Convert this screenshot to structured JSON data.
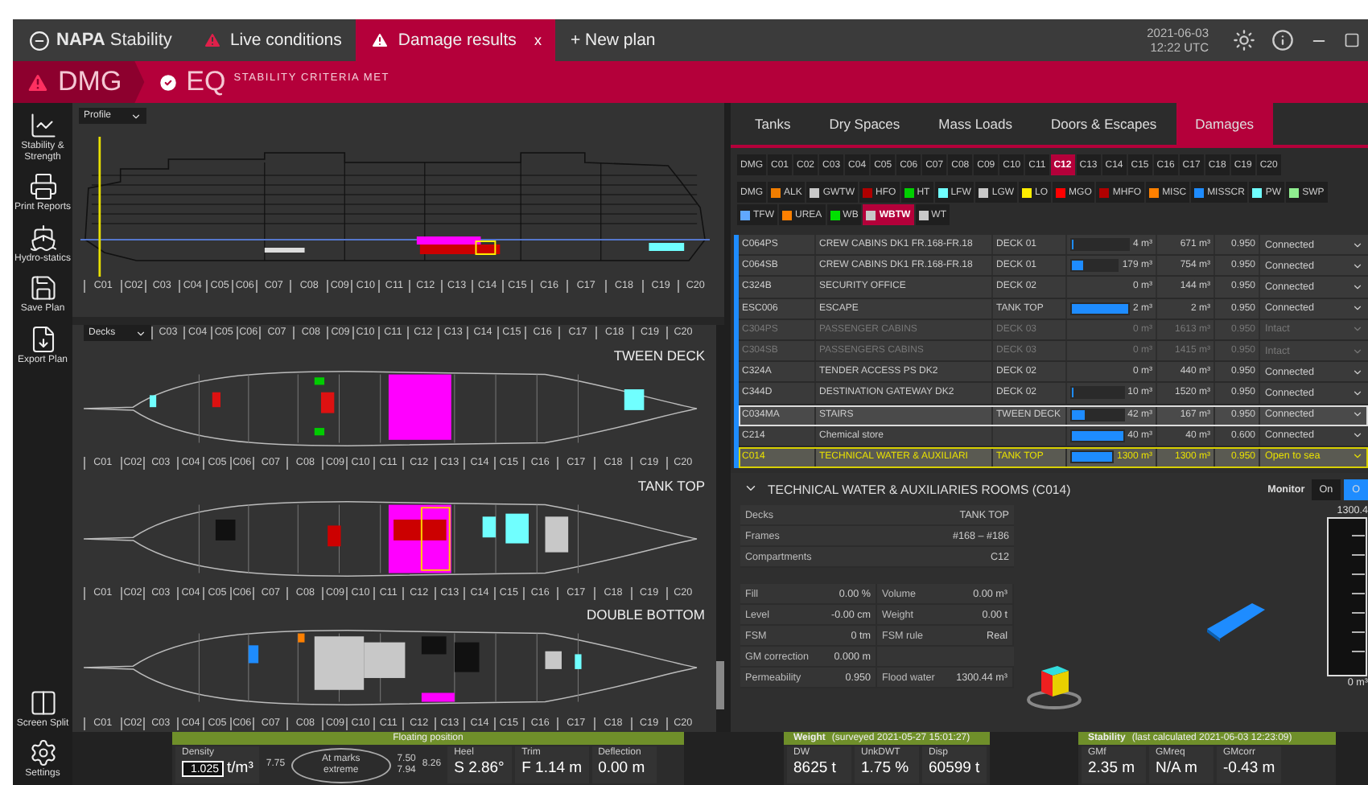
{
  "app": {
    "title": "**NAPA** Stability"
  },
  "tabs": [
    {
      "label": "Live conditions",
      "selected": false
    },
    {
      "label": "Damage results",
      "selected": true,
      "close": "x"
    },
    {
      "label": "+ New plan",
      "selected": false
    }
  ],
  "clock": {
    "date": "2021-06-03",
    "time": "12:22 UTC"
  },
  "status_strip": {
    "mode": "DMG",
    "state": "EQ",
    "message": "STABILITY CRITERIA MET"
  },
  "sidebar": {
    "items": [
      {
        "label": "Stability & Strength"
      },
      {
        "label": "Print Reports"
      },
      {
        "label": "Hydro-statics"
      },
      {
        "label": "Save Plan"
      },
      {
        "label": "Export Plan"
      }
    ],
    "bottom_items": [
      {
        "label": "Screen Split"
      },
      {
        "label": "Settings"
      }
    ]
  },
  "profile_view": {
    "view": "Profile",
    "scale": [
      "C01",
      "C02",
      "C03",
      "C04",
      "C05",
      "C06",
      "C07",
      "C08",
      "C09",
      "C10",
      "C11",
      "C12",
      "C13",
      "C14",
      "C15",
      "C16",
      "C17",
      "C18",
      "C19",
      "C20"
    ]
  },
  "deck_view": {
    "view": "Decks",
    "scale": [
      "C03",
      "C04",
      "C05",
      "C06",
      "C07",
      "C08",
      "C09",
      "C10",
      "C11",
      "C12",
      "C13",
      "C14",
      "C15",
      "C16",
      "C17",
      "C18",
      "C19",
      "C20"
    ],
    "decks": [
      {
        "name": "TWEEN DECK",
        "scale": [
          "C01",
          "C02",
          "C03",
          "C04",
          "C05",
          "C06",
          "C07",
          "C08",
          "C09",
          "C10",
          "C11",
          "C12",
          "C13",
          "C14",
          "C15",
          "C16",
          "C17",
          "C18",
          "C19",
          "C20"
        ]
      },
      {
        "name": "TANK TOP",
        "scale": [
          "C01",
          "C02",
          "C03",
          "C04",
          "C05",
          "C06",
          "C07",
          "C08",
          "C09",
          "C10",
          "C11",
          "C12",
          "C13",
          "C14",
          "C15",
          "C16",
          "C17",
          "C18",
          "C19",
          "C20"
        ]
      },
      {
        "name": "DOUBLE BOTTOM",
        "scale": [
          "C01",
          "C02",
          "C03",
          "C04",
          "C05",
          "C06",
          "C07",
          "C08",
          "C09",
          "C10",
          "C11",
          "C12",
          "C13",
          "C14",
          "C15",
          "C16",
          "C17",
          "C18",
          "C19",
          "C20"
        ]
      }
    ]
  },
  "panel_tabs": [
    {
      "label": "Tanks",
      "selected": false
    },
    {
      "label": "Dry Spaces",
      "selected": false
    },
    {
      "label": "Mass Loads",
      "selected": false
    },
    {
      "label": "Doors & Escapes",
      "selected": false
    },
    {
      "label": "Damages",
      "selected": true
    }
  ],
  "compartment_filters": [
    {
      "label": "DMG",
      "selected": false
    },
    {
      "label": "C01",
      "selected": false
    },
    {
      "label": "C02",
      "selected": false
    },
    {
      "label": "C03",
      "selected": false
    },
    {
      "label": "C04",
      "selected": false
    },
    {
      "label": "C05",
      "selected": false
    },
    {
      "label": "C06",
      "selected": false
    },
    {
      "label": "C07",
      "selected": false
    },
    {
      "label": "C08",
      "selected": false
    },
    {
      "label": "C09",
      "selected": false
    },
    {
      "label": "C10",
      "selected": false
    },
    {
      "label": "C11",
      "selected": false
    },
    {
      "label": "C12",
      "selected": true
    },
    {
      "label": "C13",
      "selected": false
    },
    {
      "label": "C14",
      "selected": false
    },
    {
      "label": "C15",
      "selected": false
    },
    {
      "label": "C16",
      "selected": false
    },
    {
      "label": "C17",
      "selected": false
    },
    {
      "label": "C18",
      "selected": false
    },
    {
      "label": "C19",
      "selected": false
    },
    {
      "label": "C20",
      "selected": false
    }
  ],
  "type_filters": [
    {
      "label": "DMG",
      "selected": false
    },
    {
      "label": "ALK",
      "color": "#f07d00",
      "selected": false
    },
    {
      "label": "GWTW",
      "color": "#c8c8c8",
      "selected": false
    },
    {
      "label": "HFO",
      "color": "#b00000",
      "selected": false
    },
    {
      "label": "HT",
      "color": "#00d000",
      "selected": false
    },
    {
      "label": "LFW",
      "color": "#70ffff",
      "selected": false
    },
    {
      "label": "LGW",
      "color": "#c8c8c8",
      "selected": false
    },
    {
      "label": "LO",
      "color": "#ffee00",
      "selected": false
    },
    {
      "label": "MGO",
      "color": "#ff0000",
      "selected": false
    },
    {
      "label": "MHFO",
      "color": "#b00000",
      "selected": false
    },
    {
      "label": "MISC",
      "color": "#ff8000",
      "selected": false
    },
    {
      "label": "MISSCR",
      "color": "#1e8cff",
      "selected": false
    },
    {
      "label": "PW",
      "color": "#70ffff",
      "selected": false
    },
    {
      "label": "SWP",
      "color": "#90ee90",
      "selected": false
    },
    {
      "label": "TFW",
      "color": "#60a8ff",
      "selected": false
    },
    {
      "label": "UREA",
      "color": "#ff8000",
      "selected": false
    },
    {
      "label": "WB",
      "color": "#00e000",
      "selected": false
    },
    {
      "label": "WBTW",
      "color": "#c8c8c8",
      "selected": true
    },
    {
      "label": "WT",
      "color": "#c8c8c8",
      "selected": false
    }
  ],
  "damage_table": {
    "rows": [
      {
        "id": "C064PS",
        "name": "CREW CABINS DK1 FR.168-FR.18",
        "deck": "DECK 01",
        "volume": "4 m³",
        "capacity": "671 m³",
        "permeability": "0.950",
        "status": "Connected",
        "level": 0.01,
        "selected": false,
        "highlighted": false,
        "disabled": false
      },
      {
        "id": "C064SB",
        "name": "CREW CABINS DK1 FR.168-FR.18",
        "deck": "DECK 01",
        "volume": "179 m³",
        "capacity": "754 m³",
        "permeability": "0.950",
        "status": "Connected",
        "level": 0.24,
        "selected": false,
        "highlighted": false,
        "disabled": false
      },
      {
        "id": "C324B",
        "name": "SECURITY OFFICE",
        "deck": "DECK 02",
        "volume": "0 m³",
        "capacity": "144 m³",
        "permeability": "0.950",
        "status": "Connected",
        "selected": false,
        "highlighted": false,
        "disabled": false
      },
      {
        "id": "ESC006",
        "name": "ESCAPE",
        "deck": "TANK TOP",
        "volume": "2 m³",
        "capacity": "2 m³",
        "permeability": "0.950",
        "status": "Connected",
        "level": 1,
        "selected": false,
        "highlighted": false,
        "disabled": false
      },
      {
        "id": "C304PS",
        "name": "PASSENGER CABINS",
        "deck": "DECK 03",
        "volume": "0 m³",
        "capacity": "1613 m³",
        "permeability": "0.950",
        "status": "Intact",
        "selected": false,
        "highlighted": false,
        "disabled": true
      },
      {
        "id": "C304SB",
        "name": "PASSENGERS CABINS",
        "deck": "DECK 03",
        "volume": "0 m³",
        "capacity": "1415 m³",
        "permeability": "0.950",
        "status": "Intact",
        "selected": false,
        "highlighted": false,
        "disabled": true
      },
      {
        "id": "C324A",
        "name": "TENDER ACCESS PS DK2",
        "deck": "DECK 02",
        "volume": "0 m³",
        "capacity": "440 m³",
        "permeability": "0.950",
        "status": "Connected",
        "selected": false,
        "highlighted": false,
        "disabled": false
      },
      {
        "id": "C344D",
        "name": "DESTINATION GATEWAY DK2",
        "deck": "DECK 02",
        "volume": "10 m³",
        "capacity": "1520 m³",
        "permeability": "0.950",
        "status": "Connected",
        "level": 0.01,
        "selected": false,
        "highlighted": false,
        "disabled": false
      },
      {
        "id": "C034MA",
        "name": "STAIRS",
        "deck": "TWEEN DECK",
        "volume": "42 m³",
        "capacity": "167 m³",
        "permeability": "0.950",
        "status": "Connected",
        "level": 0.25,
        "selected": false,
        "highlighted": true,
        "disabled": false
      },
      {
        "id": "C214",
        "name": "Chemical store",
        "volume": "40 m³",
        "capacity": "40 m³",
        "permeability": "0.600",
        "status": "Connected",
        "level": 1,
        "selected": false,
        "highlighted": false,
        "disabled": false
      },
      {
        "id": "C014",
        "name": "TECHNICAL WATER & AUXILIARI",
        "deck": "TANK TOP",
        "volume": "1300 m³",
        "capacity": "1300 m³",
        "permeability": "0.950",
        "status": "Open to sea",
        "level": 1,
        "selected": true,
        "highlighted": false,
        "disabled": false
      }
    ]
  },
  "details": {
    "title": "TECHNICAL WATER & AUXILIARIES ROOMS (C014)",
    "expanded": true,
    "info": [
      {
        "label": "Decks",
        "value": "TANK TOP"
      },
      {
        "label": "Frames",
        "value": "#168 – #186"
      },
      {
        "label": "Compartments",
        "value": "C12"
      }
    ],
    "properties": [
      {
        "cells": [
          {
            "label": "Fill",
            "value": "0.00 %"
          },
          {
            "label": "Volume",
            "value": "0.00 m³"
          }
        ]
      },
      {
        "cells": [
          {
            "label": "Level",
            "value": "-0.00 cm"
          },
          {
            "label": "Weight",
            "value": "0.00 t"
          }
        ]
      },
      {
        "cells": [
          {
            "label": "FSM",
            "value": "0 tm"
          },
          {
            "label": "FSM rule",
            "value": "Real"
          }
        ]
      },
      {
        "cells": [
          {
            "label": "GM correction",
            "value": "0.000 m"
          }
        ]
      },
      {
        "cells": [
          {
            "label": "Permeability",
            "value": "0.950"
          },
          {
            "label": "Flood water",
            "value": "1300.44 m³"
          }
        ]
      }
    ],
    "monitor": {
      "label": "Monitor",
      "options": [
        {
          "label": "On",
          "selected": false
        },
        {
          "label": "O",
          "selected": true
        }
      ]
    },
    "gauge": {
      "max_label": "1300.4",
      "min_label": "0 m³"
    }
  },
  "floating_position": {
    "title": "Floating position",
    "density": {
      "label": "Density",
      "value": "1.025",
      "unit": "t/m³"
    },
    "draft_aft": "7.75",
    "marks_label": "At marks",
    "marks_sub": "extreme",
    "marks_readings": [
      "7.50",
      "7.94"
    ],
    "draft_fwd": "8.26",
    "readings": [
      {
        "label": "Heel",
        "value": "S 2.86°"
      },
      {
        "label": "Trim",
        "value": "F 1.14 m"
      },
      {
        "label": "Deflection",
        "value": "0.00 m"
      }
    ]
  },
  "weight": {
    "title": "Weight",
    "note": "(surveyed 2021-05-27 15:01:27)",
    "readings": [
      {
        "label": "DW",
        "value": "8625 t"
      },
      {
        "label": "UnkDWT",
        "value": "1.75 %"
      },
      {
        "label": "Disp",
        "value": "60599 t"
      }
    ]
  },
  "stability": {
    "title": "Stability",
    "note": "(last calculated 2021-06-03 12:23:09)",
    "readings": [
      {
        "label": "GMf",
        "value": "2.35 m"
      },
      {
        "label": "GMreq",
        "value": "N/A m"
      },
      {
        "label": "GMcorr",
        "value": "-0.43 m"
      }
    ]
  }
}
